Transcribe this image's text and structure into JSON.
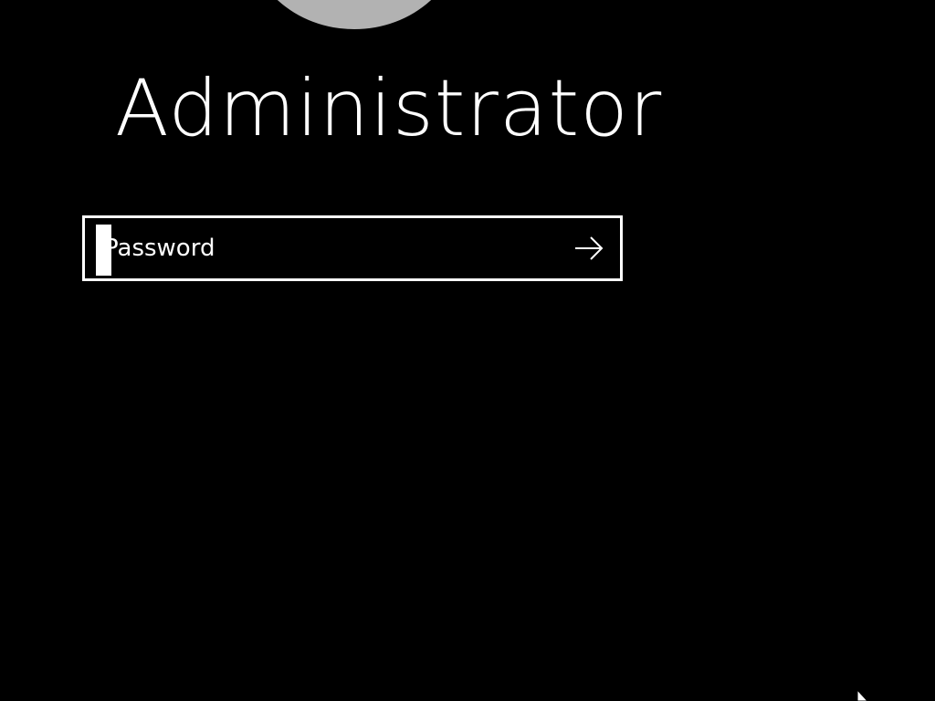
{
  "login": {
    "user_name": "Administrator",
    "password_placeholder": "Password"
  },
  "icons": {
    "submit": "arrow-right-icon",
    "avatar": "user-avatar",
    "cursor": "mouse-pointer-icon"
  },
  "colors": {
    "background": "#000000",
    "text": "#ffffff",
    "avatar": "#b2b2b2",
    "field_border": "#ffffff"
  }
}
